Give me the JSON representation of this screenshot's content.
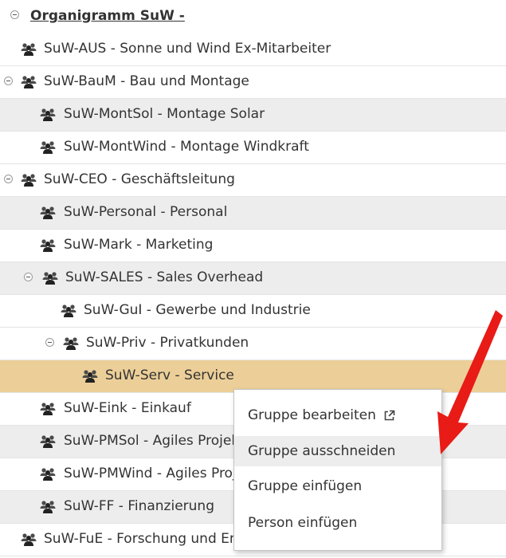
{
  "tree": {
    "root_label": "Organigramm SuW -",
    "rows": [
      {
        "label": "SuW-AUS - Sonne und Wind Ex-Mitarbeiter"
      },
      {
        "label": "SuW-BauM - Bau und Montage"
      },
      {
        "label": "SuW-MontSol - Montage Solar"
      },
      {
        "label": "SuW-MontWind - Montage Windkraft"
      },
      {
        "label": "SuW-CEO - Geschäftsleitung"
      },
      {
        "label": "SuW-Personal - Personal"
      },
      {
        "label": "SuW-Mark - Marketing"
      },
      {
        "label": "SuW-SALES - Sales Overhead"
      },
      {
        "label": "SuW-GuI - Gewerbe und Industrie"
      },
      {
        "label": "SuW-Priv - Privatkunden"
      },
      {
        "label": "SuW-Serv - Service"
      },
      {
        "label": "SuW-Eink - Einkauf"
      },
      {
        "label": "SuW-PMSol - Agiles Projektmanagement Solar"
      },
      {
        "label": "SuW-PMWind - Agiles Projektmanagement Wind"
      },
      {
        "label": "SuW-FF - Finanzierung"
      },
      {
        "label": "SuW-FuE - Forschung und Entwicklung"
      }
    ]
  },
  "context_menu": {
    "items": [
      {
        "label": "Gruppe bearbeiten"
      },
      {
        "label": "Gruppe ausschneiden"
      },
      {
        "label": "Gruppe einfügen"
      },
      {
        "label": "Person einfügen"
      }
    ]
  },
  "icons": {
    "group": "group-icon",
    "toggle": "collapse-toggle-icon",
    "external": "external-link-icon",
    "annotation": "red-arrow-annotation"
  },
  "colors": {
    "selected_row": "#eccf98",
    "shaded_row": "#ededed",
    "arrow": "#e81b16"
  }
}
